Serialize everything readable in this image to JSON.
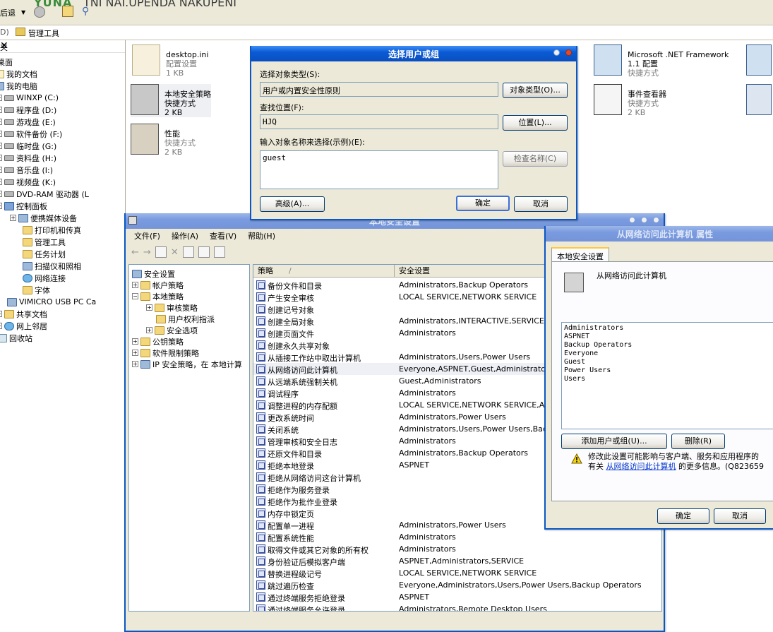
{
  "explorer": {
    "back_label": "后退",
    "title_part1": "YUNA",
    "title_part2": "TNI NAI.UPENDA NAKUPENI",
    "address_prefix": "D)",
    "address_path": "管理工具",
    "folders_header": "夹",
    "tree": [
      "桌面",
      "我的文档",
      "我的电脑",
      "WINXP (C:)",
      "程序盘 (D:)",
      "游戏盘 (E:)",
      "软件备份 (F:)",
      "临时盘 (G:)",
      "资料盘 (H:)",
      "音乐盘 (I:)",
      "视频盘 (K:)",
      "DVD-RAM 驱动器 (L",
      "控制面板",
      "便携媒体设备",
      "打印机和传真",
      "管理工具",
      "任务计划",
      "扫描仪和照相",
      "网络连接",
      "字体",
      "VIMICRO USB PC Ca",
      "共享文档",
      "网上邻居",
      "回收站"
    ],
    "files": [
      {
        "name": "desktop.ini",
        "type": "配置设置",
        "size": "1 KB"
      },
      {
        "name": "本地安全策略",
        "type": "快捷方式",
        "size": "2 KB"
      },
      {
        "name": "性能",
        "type": "快捷方式",
        "size": "2 KB"
      },
      {
        "name": "Microsoft .NET Framework 1.1 配置",
        "type": "快捷方式",
        "size": ""
      },
      {
        "name": "事件查看器",
        "type": "快捷方式",
        "size": "2 KB"
      }
    ]
  },
  "select_dialog": {
    "title": "选择用户或组",
    "object_type_label": "选择对象类型(S):",
    "object_type_value": "用户或内置安全性原则",
    "object_type_button": "对象类型(O)...",
    "location_label": "查找位置(F):",
    "location_value": "HJQ",
    "location_button": "位置(L)...",
    "enter_names_label": "输入对象名称来选择(示例)(E):",
    "names_value": "guest",
    "check_names_button": "检查名称(C)",
    "advanced_button": "高级(A)...",
    "ok_button": "确定",
    "cancel_button": "取消"
  },
  "local_security": {
    "title": "本地安全设置",
    "menu": [
      "文件(F)",
      "操作(A)",
      "查看(V)",
      "帮助(H)"
    ],
    "tree": [
      "安全设置",
      "帐户策略",
      "本地策略",
      "审核策略",
      "用户权利指派",
      "安全选项",
      "公钥策略",
      "软件限制策略",
      "IP 安全策略，在 本地计算"
    ],
    "col_policy": "策略",
    "col_sort": "/",
    "col_setting": "安全设置",
    "policies": [
      {
        "name": "备份文件和目录",
        "setting": "Administrators,Backup Operators"
      },
      {
        "name": "产生安全审核",
        "setting": "LOCAL SERVICE,NETWORK SERVICE"
      },
      {
        "name": "创建记号对象",
        "setting": ""
      },
      {
        "name": "创建全局对象",
        "setting": "Administrators,INTERACTIVE,SERVICE"
      },
      {
        "name": "创建页面文件",
        "setting": "Administrators"
      },
      {
        "name": "创建永久共享对象",
        "setting": ""
      },
      {
        "name": "从插接工作站中取出计算机",
        "setting": "Administrators,Users,Power Users"
      },
      {
        "name": "从网络访问此计算机",
        "setting": "Everyone,ASPNET,Guest,Administrators,Us"
      },
      {
        "name": "从远端系统强制关机",
        "setting": "Guest,Administrators"
      },
      {
        "name": "调试程序",
        "setting": "Administrators"
      },
      {
        "name": "调整进程的内存配额",
        "setting": "LOCAL SERVICE,NETWORK SERVICE,Admin"
      },
      {
        "name": "更改系统时间",
        "setting": "Administrators,Power Users"
      },
      {
        "name": "关闭系统",
        "setting": "Administrators,Users,Power Users,Backup"
      },
      {
        "name": "管理审核和安全日志",
        "setting": "Administrators"
      },
      {
        "name": "还原文件和目录",
        "setting": "Administrators,Backup Operators"
      },
      {
        "name": "拒绝本地登录",
        "setting": "ASPNET"
      },
      {
        "name": "拒绝从网络访问这台计算机",
        "setting": ""
      },
      {
        "name": "拒绝作为服务登录",
        "setting": ""
      },
      {
        "name": "拒绝作为批作业登录",
        "setting": ""
      },
      {
        "name": "内存中锁定页",
        "setting": ""
      },
      {
        "name": "配置单一进程",
        "setting": "Administrators,Power Users"
      },
      {
        "name": "配置系统性能",
        "setting": "Administrators"
      },
      {
        "name": "取得文件或其它对象的所有权",
        "setting": "Administrators"
      },
      {
        "name": "身份验证后模拟客户端",
        "setting": "ASPNET,Administrators,SERVICE"
      },
      {
        "name": "替换进程级记号",
        "setting": "LOCAL SERVICE,NETWORK SERVICE"
      },
      {
        "name": "跳过遍历检查",
        "setting": "Everyone,Administrators,Users,Power Users,Backup Operators"
      },
      {
        "name": "通过终端服务拒绝登录",
        "setting": "ASPNET"
      },
      {
        "name": "通过终端服务允许登录",
        "setting": "Administrators,Remote Desktop Users"
      }
    ]
  },
  "props_dialog": {
    "title": "从网络访问此计算机 属性",
    "tab": "本地安全设置",
    "policy_name": "从网络访问此计算机",
    "users": [
      "Administrators",
      "ASPNET",
      "Backup Operators",
      "Everyone",
      "Guest",
      "Power Users",
      "Users"
    ],
    "add_button": "添加用户或组(U)...",
    "remove_button": "删除(R)",
    "warning_line1": "修改此设置可能影响与客户端、服务和应用程序的",
    "warning_line2_pre": "有关",
    "warning_link": "从网络访问此计算机",
    "warning_line2_post": "的更多信息。(Q823659",
    "ok_button": "确定",
    "cancel_button": "取消"
  }
}
